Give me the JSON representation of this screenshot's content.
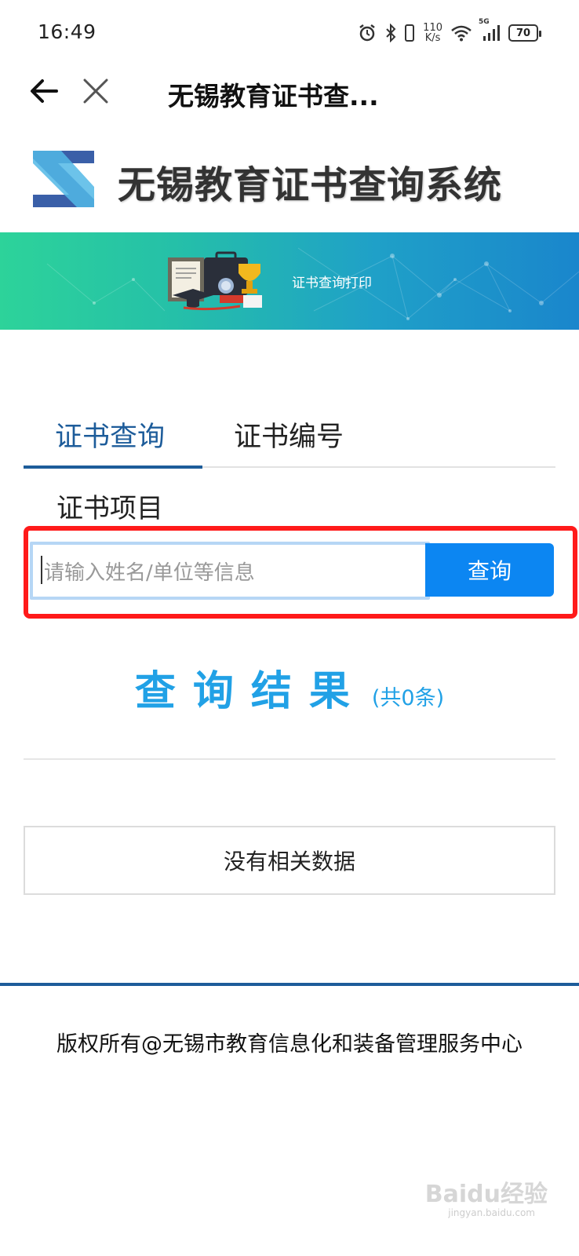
{
  "status_bar": {
    "time": "16:49",
    "net_speed_value": "110",
    "net_speed_unit": "K/s",
    "network": "5G",
    "battery": "70",
    "icons": [
      "alarm-icon",
      "bluetooth-icon",
      "vibrate-icon",
      "wifi-icon",
      "signal-icon",
      "battery-icon"
    ]
  },
  "nav": {
    "title": "无锡教育证书查...",
    "back_icon": "arrow-left-icon",
    "close_icon": "close-icon"
  },
  "site": {
    "title": "无锡教育证书查询系统",
    "logo": "z-logo-icon"
  },
  "banner": {
    "text": "证书查询打印",
    "illustration": "certificate-trophy-illustration"
  },
  "tabs": [
    {
      "label": "证书查询",
      "active": true
    },
    {
      "label": "证书编号",
      "active": false
    }
  ],
  "section_label": "证书项目",
  "search": {
    "placeholder": "请输入姓名/单位等信息",
    "button_label": "查询"
  },
  "results": {
    "title": "查询结果",
    "count_text": "(共0条)",
    "empty_text": "没有相关数据"
  },
  "footer": {
    "copyright": "版权所有@无锡市教育信息化和装备管理服务中心"
  },
  "watermark": {
    "text": "Baidu经验",
    "sub": "jingyan.baidu.com"
  },
  "colors": {
    "primary": "#1d5c9a",
    "accent_blue": "#21a1e6",
    "button_blue": "#0c86f2",
    "highlight_red": "#ff1a1a",
    "banner_green": "#2dd39a",
    "banner_blue": "#1a86cc"
  }
}
